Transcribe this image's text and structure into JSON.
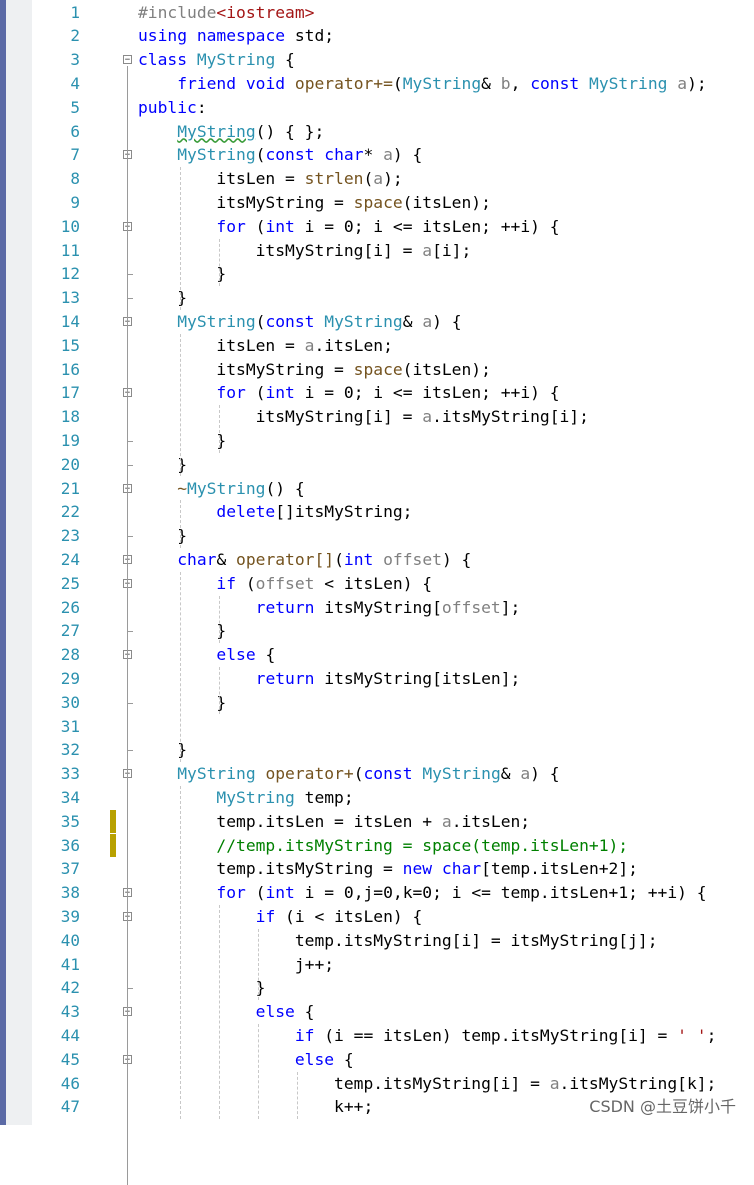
{
  "editor": {
    "line_numbers": [
      "1",
      "2",
      "3",
      "4",
      "5",
      "6",
      "7",
      "8",
      "9",
      "10",
      "11",
      "12",
      "13",
      "14",
      "15",
      "16",
      "17",
      "18",
      "19",
      "20",
      "21",
      "22",
      "23",
      "24",
      "25",
      "26",
      "27",
      "28",
      "29",
      "30",
      "31",
      "32",
      "33",
      "34",
      "35",
      "36",
      "37",
      "38",
      "39",
      "40",
      "41",
      "42",
      "43",
      "44",
      "45",
      "46",
      "47"
    ],
    "lines": [
      "#include<iostream>",
      "using namespace std;",
      "class MyString {",
      "    friend void operator+=(MyString& b, const MyString a);",
      "public:",
      "    MyString() { };",
      "    MyString(const char* a) {",
      "        itsLen = strlen(a);",
      "        itsMyString = space(itsLen);",
      "        for (int i = 0; i <= itsLen; ++i) {",
      "            itsMyString[i] = a[i];",
      "        }",
      "    }",
      "    MyString(const MyString& a) {",
      "        itsLen = a.itsLen;",
      "        itsMyString = space(itsLen);",
      "        for (int i = 0; i <= itsLen; ++i) {",
      "            itsMyString[i] = a.itsMyString[i];",
      "        }",
      "    }",
      "    ~MyString() {",
      "        delete[]itsMyString;",
      "    }",
      "    char& operator[](int offset) {",
      "        if (offset < itsLen) {",
      "            return itsMyString[offset];",
      "        }",
      "        else {",
      "            return itsMyString[itsLen];",
      "        }",
      "",
      "    }",
      "    MyString operator+(const MyString& a) {",
      "        MyString temp;",
      "        temp.itsLen = itsLen + a.itsLen;",
      "        //temp.itsMyString = space(temp.itsLen+1);",
      "        temp.itsMyString = new char[temp.itsLen+2];",
      "        for (int i = 0,j=0,k=0; i <= temp.itsLen+1; ++i) {",
      "            if (i < itsLen) {",
      "                temp.itsMyString[i] = itsMyString[j];",
      "                j++;",
      "            }",
      "            else {",
      "                if (i == itsLen) temp.itsMyString[i] = ' ';",
      "                else {",
      "                    temp.itsMyString[i] = a.itsMyString[k];",
      "                    k++;"
    ]
  },
  "watermark": "CSDN @土豆饼小千",
  "colors": {
    "keyword": "#0000ff",
    "type": "#2b91af",
    "function": "#74531f",
    "preprocessor": "#808080",
    "string": "#a31515",
    "comment": "#008000",
    "line_number": "#2b91af",
    "change_marker": "#b8a100"
  }
}
